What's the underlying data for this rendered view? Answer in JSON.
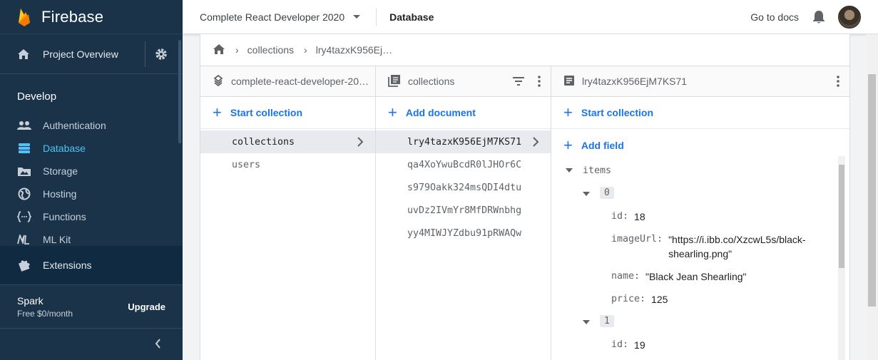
{
  "app": {
    "name": "Firebase"
  },
  "sidebar": {
    "overview_label": "Project Overview",
    "section_title": "Develop",
    "items": [
      {
        "label": "Authentication",
        "icon": "people-icon",
        "active": false
      },
      {
        "label": "Database",
        "icon": "database-icon",
        "active": true
      },
      {
        "label": "Storage",
        "icon": "image-icon",
        "active": false
      },
      {
        "label": "Hosting",
        "icon": "globe-icon",
        "active": false
      },
      {
        "label": "Functions",
        "icon": "functions-icon",
        "active": false
      },
      {
        "label": "ML Kit",
        "icon": "mlkit-icon",
        "active": false
      }
    ],
    "extensions_label": "Extensions",
    "plan": {
      "name": "Spark",
      "price": "Free $0/month",
      "upgrade": "Upgrade"
    }
  },
  "topbar": {
    "project": "Complete React Developer 2020",
    "section": "Database",
    "docs": "Go to docs"
  },
  "breadcrumb": {
    "items": [
      "collections",
      "lry4tazxK956Ej…"
    ]
  },
  "panels": {
    "root": {
      "title": "complete-react-developer-20…",
      "action": "Start collection",
      "items": [
        "collections",
        "users"
      ]
    },
    "collection": {
      "title": "collections",
      "action": "Add document",
      "items": [
        "lry4tazxK956EjM7KS71",
        "qa4XoYwuBcdR0lJHOr6C",
        "s979Oakk324msQDI4dtu",
        "uvDz2IVmYr8MfDRWnbhg",
        "yy4MIWJYZdbu91pRWAQw"
      ]
    },
    "document": {
      "title": "lry4tazxK956EjM7KS71",
      "action_collection": "Start collection",
      "action_field": "Add field",
      "field_root": "items",
      "entries": [
        {
          "index": "0",
          "id": "18",
          "imageUrl_line1": "\"https://i.ibb.co/XzcwL5s/black-",
          "imageUrl_line2": "shearling.png\"",
          "name": "\"Black Jean Shearling\"",
          "price": "125"
        },
        {
          "index": "1",
          "id": "19"
        }
      ],
      "keys": {
        "id": "id:",
        "imageUrl": "imageUrl:",
        "name": "name:",
        "price": "price:"
      }
    }
  },
  "colors": {
    "accent": "#1a73e8",
    "sidebar": "#1a3349",
    "active_nav": "#4fc3f7"
  }
}
